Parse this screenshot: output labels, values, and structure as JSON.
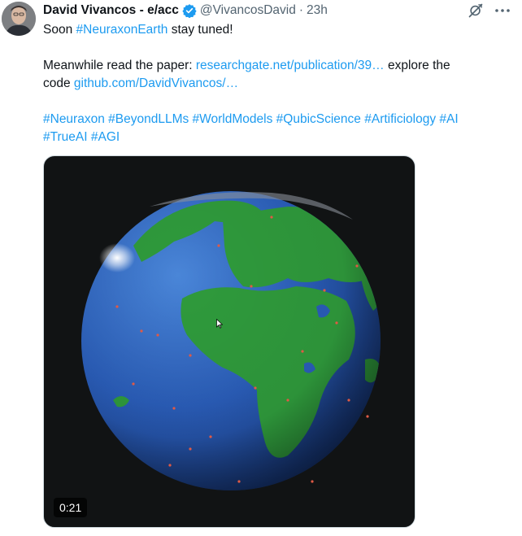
{
  "tweet": {
    "author_name": "David Vivancos - e/acc",
    "handle": "@VivancosDavid",
    "separator": "·",
    "time": "23h",
    "line1_prefix": "Soon ",
    "line1_hashtag": "#NeuraxonEarth",
    "line1_suffix": " stay tuned!",
    "line2_prefix": "Meanwhile read the paper: ",
    "paper_link": "researchgate.net/publication/39…",
    "line2_suffix": " explore the",
    "line3_prefix": "code ",
    "code_link": "github.com/DavidVivancos/…",
    "hashtags_line1": [
      "#Neuraxon",
      "#BeyondLLMs",
      "#WorldModels",
      "#QubicScience",
      "#Artificiology",
      "#AI"
    ],
    "hashtags_line2": [
      "#TrueAI",
      "#AGI"
    ]
  },
  "media": {
    "duration": "0:21",
    "ocean_color": "#2a5db8",
    "land_color": "#2f9a3c"
  },
  "colors": {
    "link": "#1d9bf0",
    "verified": "#1d9bf0",
    "muted": "#536471"
  },
  "icons": {
    "verified": "verified-badge-icon",
    "grok": "grok-icon",
    "more": "more-icon"
  }
}
